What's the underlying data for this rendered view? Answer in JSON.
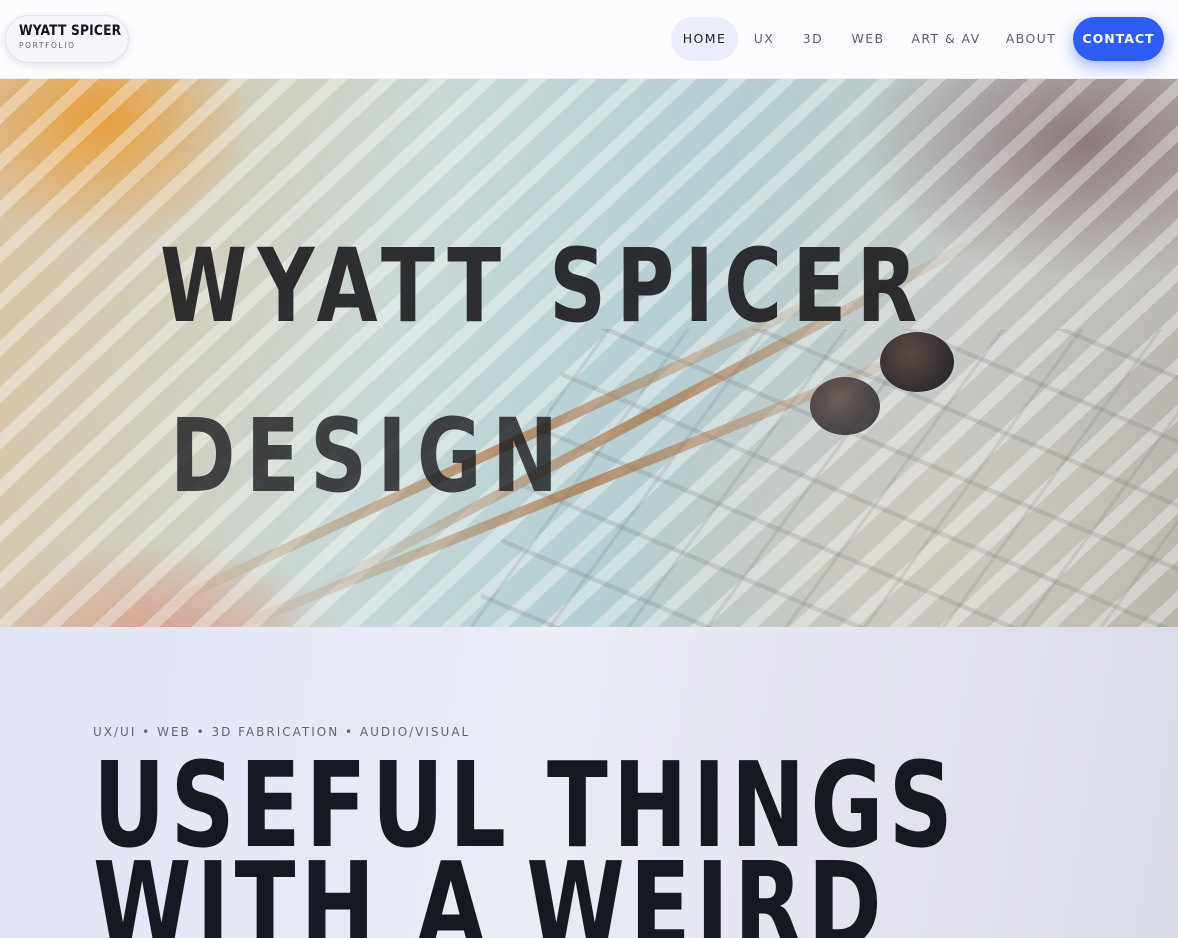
{
  "header": {
    "logo": {
      "title": "WYATT SPICER",
      "subtitle": "PORTFOLIO"
    },
    "nav": [
      {
        "label": "HOME",
        "active": true
      },
      {
        "label": "UX",
        "active": false
      },
      {
        "label": "3D",
        "active": false
      },
      {
        "label": "WEB",
        "active": false
      },
      {
        "label": "ART & AV",
        "active": false
      },
      {
        "label": "ABOUT",
        "active": false
      }
    ],
    "contact_label": "CONTACT"
  },
  "hero": {
    "title_line1": "WYATT SPICER",
    "title_line2": "DESIGN"
  },
  "intro": {
    "tagline": "UX/UI • WEB • 3D FABRICATION • AUDIO/VISUAL",
    "headline_line1": "USEFUL THINGS",
    "headline_line2": "WITH A WEIRD"
  },
  "colors": {
    "accent": "#2f5cf5",
    "nav_active_bg": "#eceefb",
    "text_dark": "#171922"
  }
}
